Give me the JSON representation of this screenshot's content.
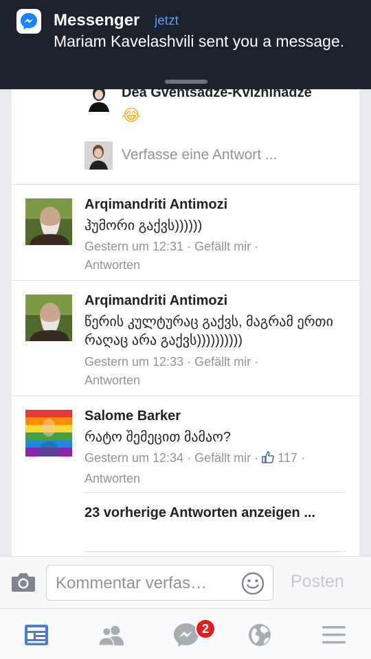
{
  "notification": {
    "app": "Messenger",
    "time": "jetzt",
    "message": "Mariam Kavelashvili sent you a message."
  },
  "feed": {
    "partial_reply": {
      "author": "Dea Gventsadze-Kvizhinadze",
      "emoji": "😂"
    },
    "reply_placeholder": "Verfasse eine Antwort ...",
    "comments": [
      {
        "author": "Arqimandriti  Antimozi",
        "text": "ჰუმორი გაქვს))))))",
        "time": "Gestern um 12:31",
        "like_label": "Gefällt mir",
        "reply_label": "Antworten"
      },
      {
        "author": "Arqimandriti  Antimozi",
        "text": "წერის კულტურაც გაქვს, მაგრამ ერთი რაღაც არა გაქვს))))))))))",
        "time": "Gestern um 12:33",
        "like_label": "Gefällt mir",
        "reply_label": "Antworten"
      },
      {
        "author": "Salome Barker",
        "text": "რატო შემეცით მამაო?",
        "time": "Gestern um 12:34",
        "like_label": "Gefällt mir",
        "like_count": "117",
        "reply_label": "Antworten"
      }
    ],
    "more_replies": "23 vorherige Antworten anzeigen ..."
  },
  "comment_bar": {
    "placeholder": "Kommentar verfas…",
    "post_label": "Posten"
  },
  "tabbar": {
    "messages_badge": "2",
    "active_color": "#4b7bd5",
    "inactive_color": "#a9adb3"
  }
}
